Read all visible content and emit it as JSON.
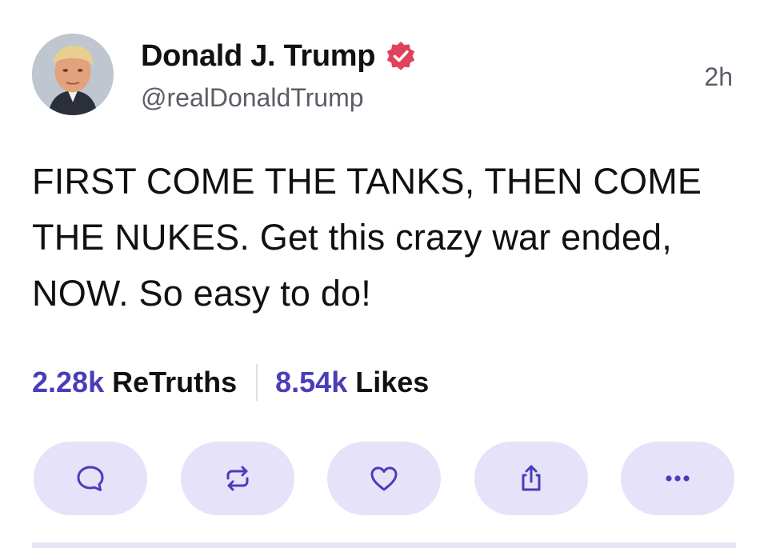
{
  "post": {
    "author": {
      "display_name": "Donald J. Trump",
      "handle": "@realDonaldTrump",
      "verified": true,
      "verified_badge_color": "#e0415b"
    },
    "timestamp": "2h",
    "text": "FIRST COME THE TANKS, THEN COME THE NUKES. Get this crazy war ended, NOW. So easy to do!",
    "stats": {
      "retruths_count": "2.28k",
      "retruths_label": "ReTruths",
      "likes_count": "8.54k",
      "likes_label": "Likes"
    },
    "actions": [
      {
        "name": "reply",
        "icon": "comment-icon"
      },
      {
        "name": "retruth",
        "icon": "repost-icon"
      },
      {
        "name": "like",
        "icon": "heart-icon"
      },
      {
        "name": "share",
        "icon": "share-icon"
      },
      {
        "name": "more",
        "icon": "more-dots-icon"
      }
    ]
  },
  "colors": {
    "accent": "#4a3db8",
    "action_background": "#e6e2fa",
    "icon_stroke": "#4a3db8",
    "secondary_text": "#5c5c66"
  }
}
